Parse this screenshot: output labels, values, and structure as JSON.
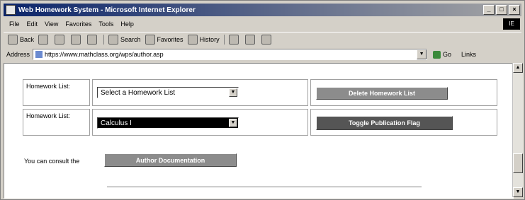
{
  "window": {
    "title": "Web Homework System - Microsoft Internet Explorer",
    "controls": [
      "_",
      "□",
      "×"
    ]
  },
  "menu": {
    "items": [
      "File",
      "Edit",
      "View",
      "Favorites",
      "Tools",
      "Help"
    ],
    "logo": "IE"
  },
  "toolbar": {
    "back": "Back",
    "search": "Search",
    "favorites": "Favorites",
    "history": "History"
  },
  "address": {
    "label": "Address",
    "url": "https://www.mathclass.org/wps/author.asp",
    "go": "Go",
    "links": "Links"
  },
  "rows": [
    {
      "label": "Homework List:",
      "select_value": "Select a Homework List",
      "button": "Delete Homework List"
    },
    {
      "label": "Homework List:",
      "select_value": "Calculus I",
      "button": "Toggle Publication Flag"
    }
  ],
  "footer": {
    "text": "You can consult the",
    "button": "Author Documentation"
  },
  "colors": {
    "title_bar": "#0a246a",
    "button_gray": "#8c8c8c",
    "button_dark": "#555555",
    "selected_select": "#000000"
  }
}
